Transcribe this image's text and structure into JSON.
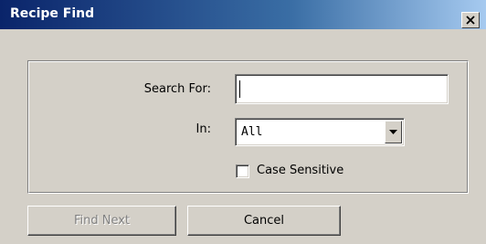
{
  "window": {
    "title": "Recipe Find"
  },
  "form": {
    "search_label": "Search For:",
    "search_value": "",
    "in_label": "In:",
    "in_selected": "All",
    "case_sensitive_label": "Case Sensitive",
    "case_sensitive_checked": false
  },
  "buttons": {
    "find_next": "Find Next",
    "find_next_enabled": false,
    "cancel": "Cancel"
  },
  "icons": {
    "close": "close-icon",
    "dropdown": "chevron-down-icon"
  },
  "colors": {
    "titlebar": "#0a246a",
    "face": "#d4d0c8",
    "disabled_text": "#808080"
  }
}
